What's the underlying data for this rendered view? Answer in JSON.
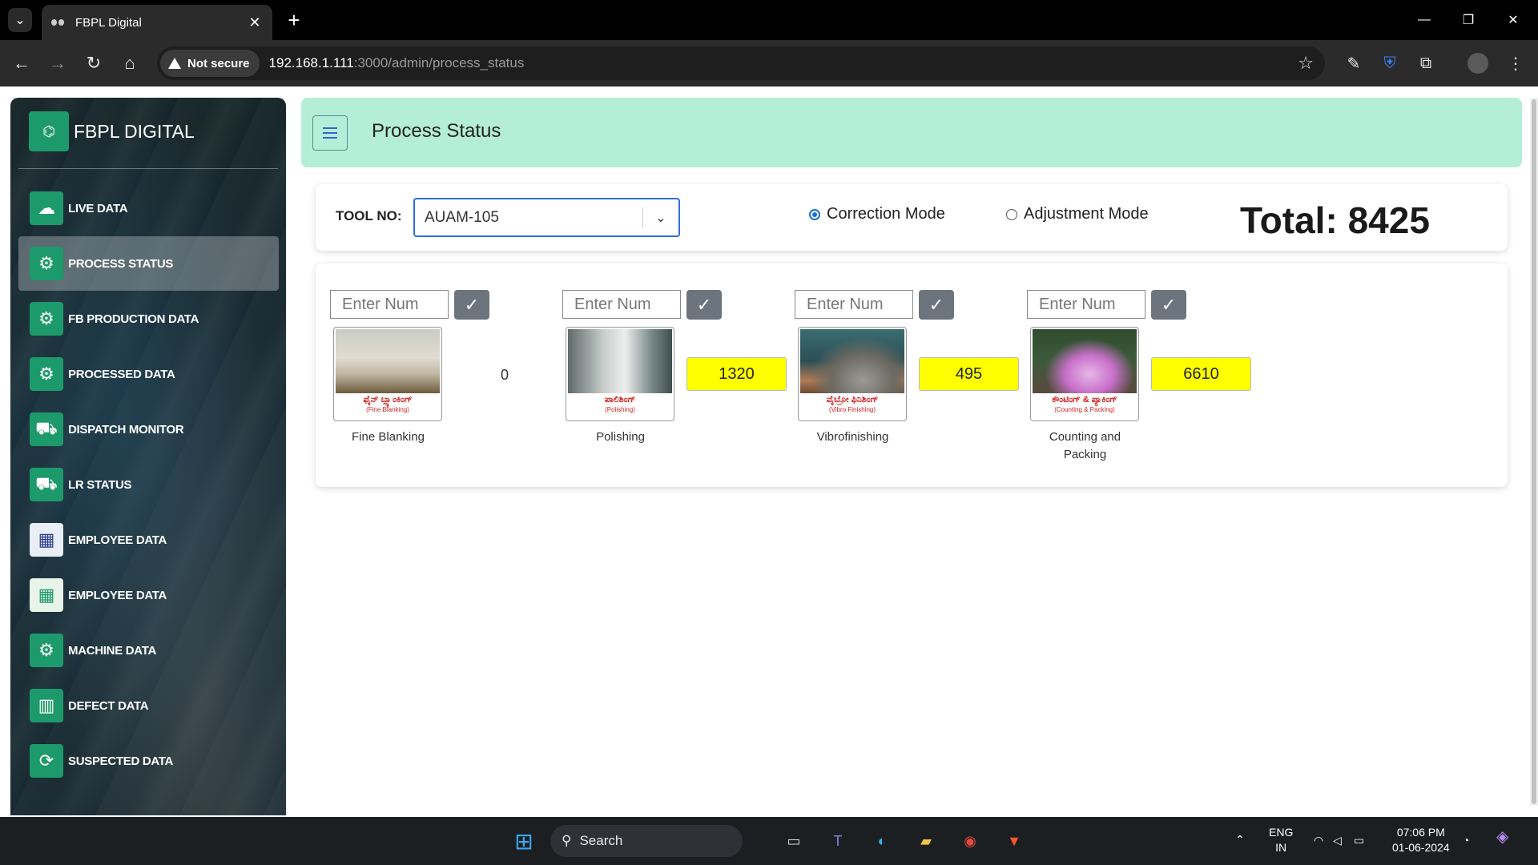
{
  "browser": {
    "tab_title": "FBPL Digital",
    "security_label": "Not secure",
    "url_host": "192.168.1.111",
    "url_path": ":3000/admin/process_status"
  },
  "sidebar": {
    "brand": "FBPL DIGITAL",
    "items": [
      {
        "label": "LIVE DATA",
        "icon": "cloud-upload-icon",
        "active": false
      },
      {
        "label": "PROCESS STATUS",
        "icon": "gears-check-icon",
        "active": true
      },
      {
        "label": "FB PRODUCTION DATA",
        "icon": "production-gear-icon",
        "active": false
      },
      {
        "label": "PROCESSED DATA",
        "icon": "processed-gears-icon",
        "active": false
      },
      {
        "label": "DISPATCH MONITOR",
        "icon": "dispatch-truck-icon",
        "active": false
      },
      {
        "label": "LR STATUS",
        "icon": "delivery-truck-icon",
        "active": false
      },
      {
        "label": "EMPLOYEE DATA",
        "icon": "employee-building-icon",
        "active": false
      },
      {
        "label": "EMPLOYEE DATA",
        "icon": "employee-building-green-icon",
        "active": false
      },
      {
        "label": "MACHINE DATA",
        "icon": "machine-gears-icon",
        "active": false
      },
      {
        "label": "DEFECT DATA",
        "icon": "defect-chart-icon",
        "active": false
      },
      {
        "label": "SUSPECTED DATA",
        "icon": "suspected-refresh-icon",
        "active": false
      }
    ]
  },
  "header": {
    "title": "Process Status"
  },
  "controls": {
    "tool_label": "TOOL NO:",
    "tool_value": "AUAM-105",
    "modes": [
      {
        "label": "Correction Mode",
        "selected": true
      },
      {
        "label": "Adjustment Mode",
        "selected": false
      }
    ],
    "total_label": "Total:",
    "total_value": "8425"
  },
  "stages": [
    {
      "placeholder": "Enter Num",
      "button": "✓",
      "caption_kn": "ಫೈನ್ ಬ್ಲ್ಯಾಂಕಿಂಗ್",
      "caption_en": "(Fine Blanking)",
      "name": "Fine Blanking",
      "count": "0",
      "highlight": false
    },
    {
      "placeholder": "Enter Num",
      "button": "✓",
      "caption_kn": "ಪಾಲಿಶಿಂಗ್",
      "caption_en": "(Polishing)",
      "name": "Polishing",
      "count": "1320",
      "highlight": true
    },
    {
      "placeholder": "Enter Num",
      "button": "✓",
      "caption_kn": "ವೈಬ್ರೋ ಫಿನಿಶಿಂಗ್",
      "caption_en": "(Vibro Finishing)",
      "name": "Vibrofinishing",
      "count": "495",
      "highlight": true
    },
    {
      "placeholder": "Enter Num",
      "button": "✓",
      "caption_kn": "ಕೌಂಟಿಂಗ್ & ಪ್ಯಾಕಿಂಗ್",
      "caption_en": "(Counting & Packing)",
      "name": "Counting and Packing",
      "count": "6610",
      "highlight": true
    }
  ],
  "taskbar": {
    "search": "Search",
    "lang_top": "ENG",
    "lang_bottom": "IN",
    "time": "07:06 PM",
    "date": "01-06-2024"
  }
}
